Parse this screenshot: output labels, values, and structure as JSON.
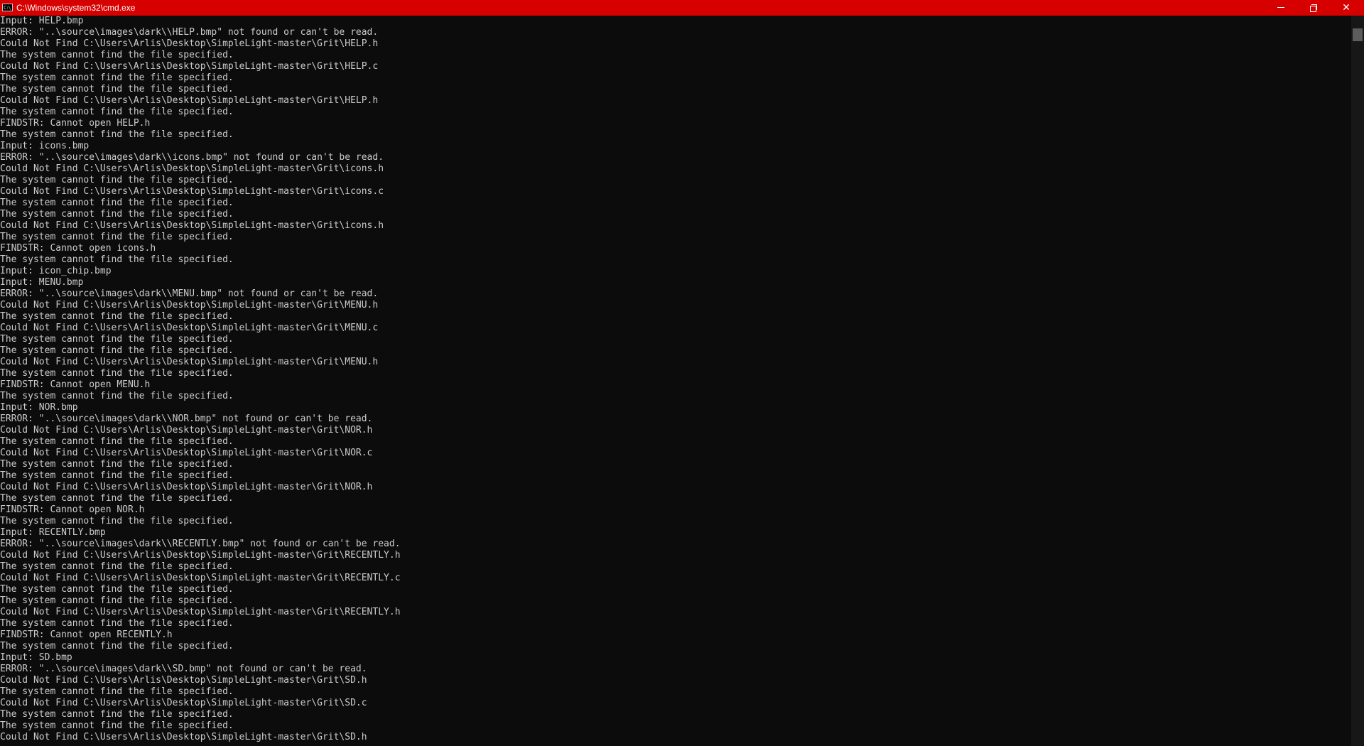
{
  "window": {
    "title": "C:\\Windows\\system32\\cmd.exe",
    "icon_text": "C:\\",
    "buttons": {
      "minimize": "minimize",
      "restore": "restore",
      "close": "✕"
    },
    "colors": {
      "titlebar": "#d70000",
      "background": "#0c0c0c",
      "text": "#cccccc"
    }
  },
  "console": {
    "lines": [
      "Input: HELP.bmp",
      "ERROR: \"..\\source\\images\\dark\\\\HELP.bmp\" not found or can't be read.",
      "Could Not Find C:\\Users\\Arlis\\Desktop\\SimpleLight-master\\Grit\\HELP.h",
      "The system cannot find the file specified.",
      "Could Not Find C:\\Users\\Arlis\\Desktop\\SimpleLight-master\\Grit\\HELP.c",
      "The system cannot find the file specified.",
      "The system cannot find the file specified.",
      "Could Not Find C:\\Users\\Arlis\\Desktop\\SimpleLight-master\\Grit\\HELP.h",
      "The system cannot find the file specified.",
      "FINDSTR: Cannot open HELP.h",
      "The system cannot find the file specified.",
      "Input: icons.bmp",
      "ERROR: \"..\\source\\images\\dark\\\\icons.bmp\" not found or can't be read.",
      "Could Not Find C:\\Users\\Arlis\\Desktop\\SimpleLight-master\\Grit\\icons.h",
      "The system cannot find the file specified.",
      "Could Not Find C:\\Users\\Arlis\\Desktop\\SimpleLight-master\\Grit\\icons.c",
      "The system cannot find the file specified.",
      "The system cannot find the file specified.",
      "Could Not Find C:\\Users\\Arlis\\Desktop\\SimpleLight-master\\Grit\\icons.h",
      "The system cannot find the file specified.",
      "FINDSTR: Cannot open icons.h",
      "The system cannot find the file specified.",
      "Input: icon_chip.bmp",
      "Input: MENU.bmp",
      "ERROR: \"..\\source\\images\\dark\\\\MENU.bmp\" not found or can't be read.",
      "Could Not Find C:\\Users\\Arlis\\Desktop\\SimpleLight-master\\Grit\\MENU.h",
      "The system cannot find the file specified.",
      "Could Not Find C:\\Users\\Arlis\\Desktop\\SimpleLight-master\\Grit\\MENU.c",
      "The system cannot find the file specified.",
      "The system cannot find the file specified.",
      "Could Not Find C:\\Users\\Arlis\\Desktop\\SimpleLight-master\\Grit\\MENU.h",
      "The system cannot find the file specified.",
      "FINDSTR: Cannot open MENU.h",
      "The system cannot find the file specified.",
      "Input: NOR.bmp",
      "ERROR: \"..\\source\\images\\dark\\\\NOR.bmp\" not found or can't be read.",
      "Could Not Find C:\\Users\\Arlis\\Desktop\\SimpleLight-master\\Grit\\NOR.h",
      "The system cannot find the file specified.",
      "Could Not Find C:\\Users\\Arlis\\Desktop\\SimpleLight-master\\Grit\\NOR.c",
      "The system cannot find the file specified.",
      "The system cannot find the file specified.",
      "Could Not Find C:\\Users\\Arlis\\Desktop\\SimpleLight-master\\Grit\\NOR.h",
      "The system cannot find the file specified.",
      "FINDSTR: Cannot open NOR.h",
      "The system cannot find the file specified.",
      "Input: RECENTLY.bmp",
      "ERROR: \"..\\source\\images\\dark\\\\RECENTLY.bmp\" not found or can't be read.",
      "Could Not Find C:\\Users\\Arlis\\Desktop\\SimpleLight-master\\Grit\\RECENTLY.h",
      "The system cannot find the file specified.",
      "Could Not Find C:\\Users\\Arlis\\Desktop\\SimpleLight-master\\Grit\\RECENTLY.c",
      "The system cannot find the file specified.",
      "The system cannot find the file specified.",
      "Could Not Find C:\\Users\\Arlis\\Desktop\\SimpleLight-master\\Grit\\RECENTLY.h",
      "The system cannot find the file specified.",
      "FINDSTR: Cannot open RECENTLY.h",
      "The system cannot find the file specified.",
      "Input: SD.bmp",
      "ERROR: \"..\\source\\images\\dark\\\\SD.bmp\" not found or can't be read.",
      "Could Not Find C:\\Users\\Arlis\\Desktop\\SimpleLight-master\\Grit\\SD.h",
      "The system cannot find the file specified.",
      "Could Not Find C:\\Users\\Arlis\\Desktop\\SimpleLight-master\\Grit\\SD.c",
      "The system cannot find the file specified.",
      "The system cannot find the file specified.",
      "Could Not Find C:\\Users\\Arlis\\Desktop\\SimpleLight-master\\Grit\\SD.h"
    ]
  }
}
